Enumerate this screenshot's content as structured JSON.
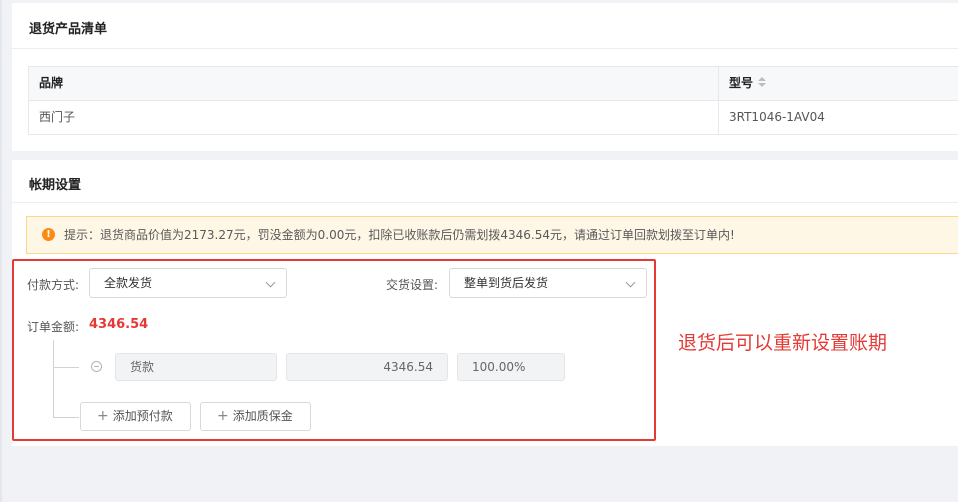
{
  "return_list": {
    "title": "退货产品清单",
    "columns": [
      "品牌",
      "型号"
    ],
    "rows": [
      [
        "西门子",
        "3RT1046-1AV04"
      ]
    ]
  },
  "account_period": {
    "title": "帐期设置",
    "alert": {
      "icon": "warning-circle-icon",
      "text": "提示：退货商品价值为2173.27元，罚没金额为0.00元，扣除已收账款后仍需划拨4346.54元，请通过订单回款划拨至订单内!"
    },
    "payment_method": {
      "label": "付款方式:",
      "value": "全款发货"
    },
    "delivery_setting": {
      "label": "交货设置:",
      "value": "整单到货后发货"
    },
    "order_amount": {
      "label": "订单金额:",
      "value": "4346.54"
    },
    "payment_item": {
      "type": "货款",
      "amount": "4346.54",
      "percent": "100.00%"
    },
    "buttons": {
      "add_prepayment": "添加预付款",
      "add_deposit": "添加质保金"
    }
  },
  "annotation": "退货后可以重新设置账期",
  "colors": {
    "accent_red": "#e53935",
    "alert_bg": "#fff7e6",
    "alert_icon": "#fa8c16"
  }
}
